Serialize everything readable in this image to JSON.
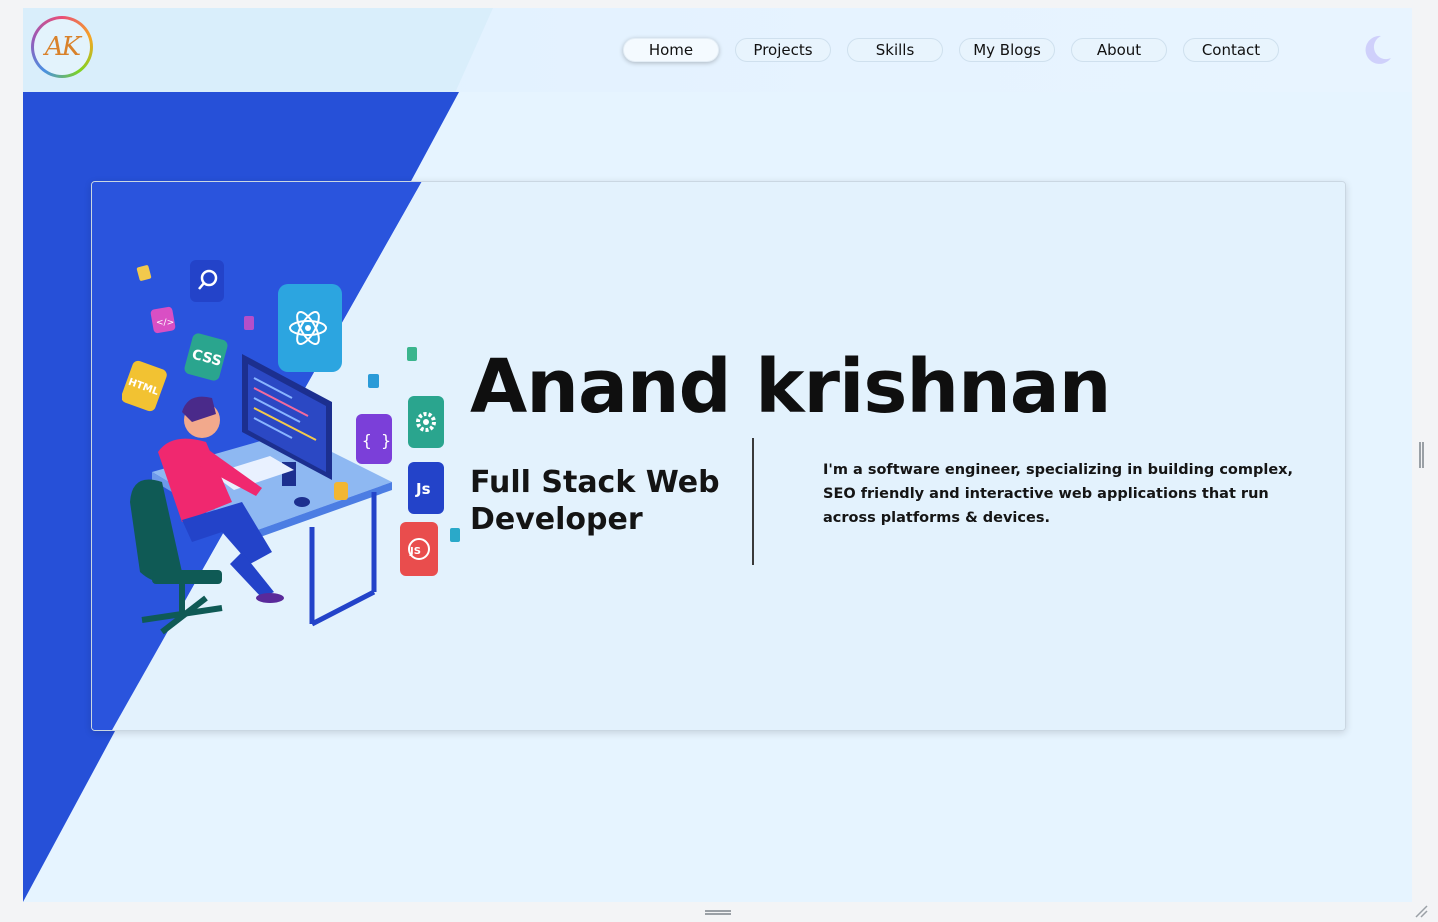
{
  "logo": {
    "text": "AK"
  },
  "nav": {
    "items": [
      {
        "label": "Home",
        "active": true
      },
      {
        "label": "Projects"
      },
      {
        "label": "Skills"
      },
      {
        "label": "My Blogs"
      },
      {
        "label": "About"
      },
      {
        "label": "Contact"
      }
    ]
  },
  "theme_toggle": {
    "icon": "moon-icon"
  },
  "hero": {
    "name": "Anand krishnan",
    "role": "Full Stack Web Developer",
    "description": "I'm a software engineer, specializing in building complex, SEO friendly and interactive web applications that run across platforms & devices.",
    "illustration": {
      "icon": "developer-at-desk-illustration",
      "badges": [
        "CSS",
        "HTML",
        "Js",
        "JS",
        "{ }",
        "</>"
      ]
    }
  },
  "colors": {
    "accent_blue": "#2650d8",
    "background": "#e6f4ff",
    "text": "#111111"
  }
}
